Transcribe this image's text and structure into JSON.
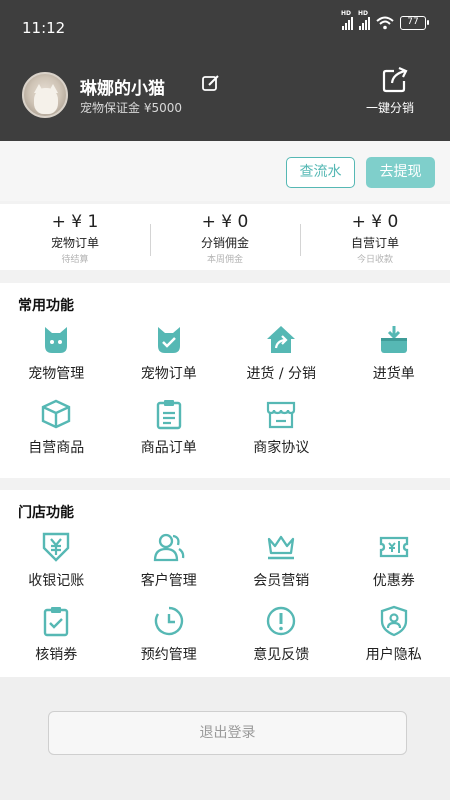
{
  "status_bar": {
    "time": "11:12",
    "battery": "77",
    "signal_badge": "HD"
  },
  "profile": {
    "username": "琳娜的小猫",
    "deposit_text": "宠物保证金 ¥5000",
    "share_label": "一键分销"
  },
  "actions": {
    "flow_label": "查流水",
    "withdraw_label": "去提现"
  },
  "stats": [
    {
      "value": "+ ¥ 1",
      "label": "宠物订单",
      "sub": "待结算"
    },
    {
      "value": "+ ¥ 0",
      "label": "分销佣金",
      "sub": "本周佣金"
    },
    {
      "value": "+ ¥ 0",
      "label": "自营订单",
      "sub": "今日收款"
    }
  ],
  "common": {
    "title": "常用功能",
    "items": [
      {
        "label": "宠物管理",
        "icon": "cat-face-icon"
      },
      {
        "label": "宠物订单",
        "icon": "cat-check-icon"
      },
      {
        "label": "进货 / 分销",
        "icon": "house-share-icon"
      },
      {
        "label": "进货单",
        "icon": "basket-icon"
      },
      {
        "label": "自营商品",
        "icon": "box-icon"
      },
      {
        "label": "商品订单",
        "icon": "clipboard-icon"
      },
      {
        "label": "商家协议",
        "icon": "store-icon"
      }
    ]
  },
  "store": {
    "title": "门店功能",
    "items": [
      {
        "label": "收银记账",
        "icon": "cash-register-icon"
      },
      {
        "label": "客户管理",
        "icon": "customers-icon"
      },
      {
        "label": "会员营销",
        "icon": "crown-icon"
      },
      {
        "label": "优惠券",
        "icon": "coupon-icon"
      },
      {
        "label": "核销券",
        "icon": "verify-coupon-icon"
      },
      {
        "label": "预约管理",
        "icon": "clock-icon"
      },
      {
        "label": "意见反馈",
        "icon": "feedback-icon"
      },
      {
        "label": "用户隐私",
        "icon": "privacy-icon"
      }
    ]
  },
  "logout_label": "退出登录",
  "colors": {
    "accent": "#56b8b4",
    "accent_light": "#7fcfcb",
    "header_bg": "#3e3e3e"
  }
}
